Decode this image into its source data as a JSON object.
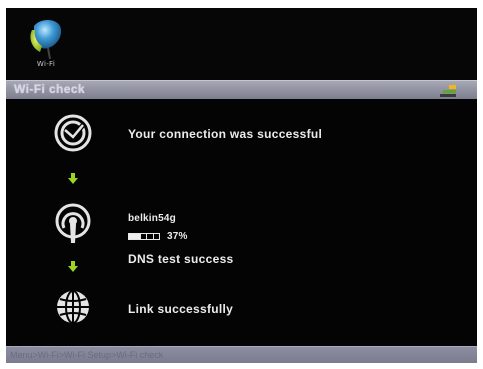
{
  "header": {
    "logo_label": "Wi-Fi",
    "logo_icon": "wifi-leaf-logo-icon"
  },
  "title_bar": {
    "title": "Wi-Fi check",
    "indicator_icon": "signal-indicator-icon"
  },
  "steps": {
    "connection": {
      "icon": "connection-check-icon",
      "text": "Your connection was successful"
    },
    "network": {
      "icon": "wireless-signal-icon",
      "ssid": "belkin54g",
      "progress_fraction": 0.37,
      "progress_text": "37%",
      "dns_text": "DNS test success"
    },
    "link": {
      "icon": "globe-icon",
      "text": "Link successfully"
    }
  },
  "status_bar": {
    "breadcrumb": "Menu>Wi-Fi>Wi-Fi Setup>Wi-Fi check"
  },
  "colors": {
    "screen_background": "#050505",
    "title_bar": "#8f90a0",
    "arrow_green": "#9bd51f",
    "text": "#ececec"
  }
}
